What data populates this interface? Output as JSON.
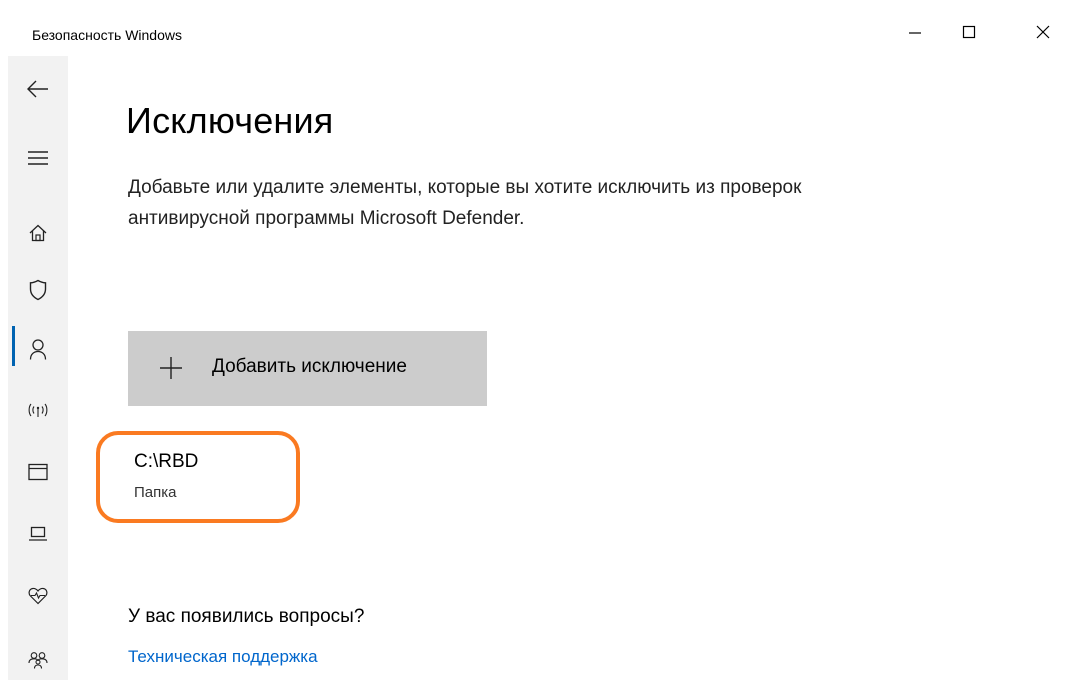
{
  "window": {
    "title": "Безопасность Windows"
  },
  "nav": {
    "items": [
      {
        "icon": "back-icon"
      },
      {
        "icon": "hamburger-menu-icon"
      },
      {
        "icon": "home-icon"
      },
      {
        "icon": "shield-icon",
        "active": true
      },
      {
        "icon": "person-icon"
      },
      {
        "icon": "wireless-signal-icon"
      },
      {
        "icon": "app-browser-icon"
      },
      {
        "icon": "laptop-icon"
      },
      {
        "icon": "heart-health-icon"
      },
      {
        "icon": "family-icon"
      }
    ],
    "accent_color": "#0063b1"
  },
  "main": {
    "title": "Исключения",
    "description": "Добавьте или удалите элементы, которые вы хотите исключить из проверок антивирусной программы Microsoft Defender.",
    "add_button_label": "Добавить исключение",
    "exclusions": [
      {
        "path": "C:\\RBD",
        "type": "Папка"
      }
    ],
    "questions_label": "У вас появились вопросы?",
    "support_link": "Техническая поддержка"
  },
  "colors": {
    "highlight": "#fa7a21",
    "link": "#0066cc",
    "button_bg": "#cccccc"
  }
}
